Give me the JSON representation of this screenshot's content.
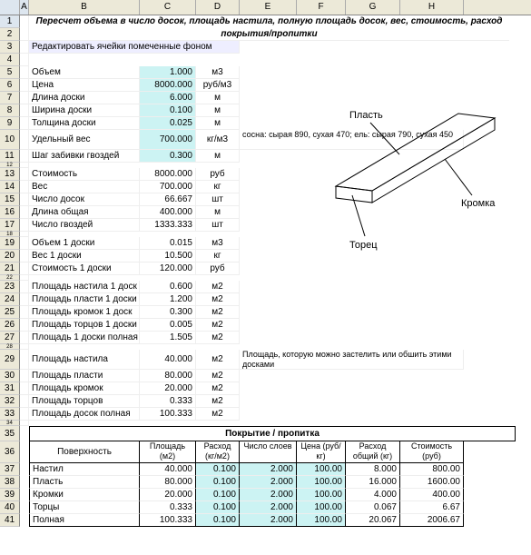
{
  "columns": [
    "A",
    "B",
    "C",
    "D",
    "E",
    "F",
    "G",
    "H"
  ],
  "row_numbers": [
    1,
    2,
    3,
    4,
    5,
    6,
    7,
    8,
    9,
    10,
    11,
    12,
    13,
    14,
    15,
    16,
    17,
    18,
    19,
    20,
    21,
    22,
    23,
    24,
    25,
    26,
    27,
    28,
    29,
    30,
    31,
    32,
    33,
    34,
    35,
    36,
    37,
    38,
    39,
    40,
    41
  ],
  "title": "Пересчет объема в число досок, площадь настила, полную площадь досок, вес, стоимость, расход покрытия/пропитки",
  "edit_hint": "Редактировать ячейки помеченные фоном",
  "inputs": [
    {
      "label": "Объем",
      "value": "1.000",
      "unit": "м3"
    },
    {
      "label": "Цена",
      "value": "8000.000",
      "unit": "руб/м3"
    },
    {
      "label": "Длина доски",
      "value": "6.000",
      "unit": "м"
    },
    {
      "label": "Ширина доски",
      "value": "0.100",
      "unit": "м"
    },
    {
      "label": "Толщина доски",
      "value": "0.025",
      "unit": "м"
    }
  ],
  "density": {
    "label": "Удельный вес",
    "value": "700.000",
    "unit": "кг/м3",
    "note": "сосна: сырая 890, сухая 470; ель: сырая 790, сухая 450"
  },
  "nail_step": {
    "label": "Шаг забивки гвоздей",
    "value": "0.300",
    "unit": "м"
  },
  "results1": [
    {
      "label": "Стоимость",
      "value": "8000.000",
      "unit": "руб"
    },
    {
      "label": "Вес",
      "value": "700.000",
      "unit": "кг"
    },
    {
      "label": "Число досок",
      "value": "66.667",
      "unit": "шт"
    },
    {
      "label": "Длина общая",
      "value": "400.000",
      "unit": "м"
    },
    {
      "label": "Число гвоздей",
      "value": "1333.333",
      "unit": "шт"
    }
  ],
  "per_board": [
    {
      "label": "Объем 1 доски",
      "value": "0.015",
      "unit": "м3"
    },
    {
      "label": "Вес 1 доски",
      "value": "10.500",
      "unit": "кг"
    },
    {
      "label": "Стоимость 1 доски",
      "value": "120.000",
      "unit": "руб"
    }
  ],
  "per_board_area": [
    {
      "label": "Площадь настила 1 доск",
      "value": "0.600",
      "unit": "м2"
    },
    {
      "label": "Площадь пласти 1 доски",
      "value": "1.200",
      "unit": "м2"
    },
    {
      "label": "Площадь кромок 1 доск",
      "value": "0.300",
      "unit": "м2"
    },
    {
      "label": "Площадь торцов 1 доски",
      "value": "0.005",
      "unit": "м2"
    },
    {
      "label": "Площадь 1 доски полная",
      "value": "1.505",
      "unit": "м2"
    }
  ],
  "totals_area": [
    {
      "label": "Площадь настила",
      "value": "40.000",
      "unit": "м2",
      "note": "Площадь, которую можно застелить или обшить этими досками"
    },
    {
      "label": "Площадь пласти",
      "value": "80.000",
      "unit": "м2"
    },
    {
      "label": "Площадь кромок",
      "value": "20.000",
      "unit": "м2"
    },
    {
      "label": "Площадь торцов",
      "value": "0.333",
      "unit": "м2"
    },
    {
      "label": "Площадь досок полная",
      "value": "100.333",
      "unit": "м2"
    }
  ],
  "diagram_labels": {
    "plast": "Пласть",
    "kromka": "Кромка",
    "torec": "Торец"
  },
  "table": {
    "title": "Покрытие / пропитка",
    "headers": [
      "Поверхность",
      "Площадь (м2)",
      "Расход (кг/м2)",
      "Число слоев",
      "Цена (руб/кг)",
      "Расход общий (кг)",
      "Стоимость (руб)"
    ],
    "rows": [
      [
        "Настил",
        "40.000",
        "0.100",
        "2.000",
        "100.00",
        "8.000",
        "800.00"
      ],
      [
        "Пласть",
        "80.000",
        "0.100",
        "2.000",
        "100.00",
        "16.000",
        "1600.00"
      ],
      [
        "Кромки",
        "20.000",
        "0.100",
        "2.000",
        "100.00",
        "4.000",
        "400.00"
      ],
      [
        "Торцы",
        "0.333",
        "0.100",
        "2.000",
        "100.00",
        "0.067",
        "6.67"
      ],
      [
        "Полная",
        "100.333",
        "0.100",
        "2.000",
        "100.00",
        "20.067",
        "2006.67"
      ]
    ]
  }
}
